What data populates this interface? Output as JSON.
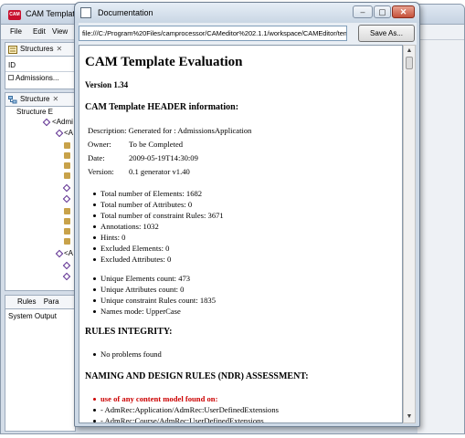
{
  "main_window": {
    "title": "CAM Template",
    "menu": [
      "File",
      "Edit",
      "View"
    ],
    "structures_panel": {
      "tab": "Structures",
      "id_label": "ID",
      "item": "Admissions..."
    },
    "structure_panel": {
      "tab": "Structure",
      "tab_suffix": "Structure E",
      "root_node": "Structure E",
      "child_prefix_1": "<Admi",
      "child_prefix_2": "<A",
      "child_prefix_3": "<A"
    },
    "bottom_tabs": [
      "Rules",
      "Para"
    ],
    "system_output_label": "System Output"
  },
  "doc_window": {
    "title": "Documentation",
    "url": "file:///C:/Program%20Files/camprocessor/CAMeditor%202.1.1/workspace/CAMEditor/tem",
    "save_as": "Save As..."
  },
  "report": {
    "title": "CAM Template Evaluation",
    "version": "Version 1.34",
    "header_section": "CAM Template HEADER information:",
    "description": "Description: Generated for : AdmissionsApplication",
    "owner_label": "Owner:",
    "owner_value": "To be Completed",
    "date_label": "Date:",
    "date_value": "2009-05-19T14:30:09",
    "version_label": "Version:",
    "version_value": "0.1 generator v1.40",
    "counts": [
      "Total number of Elements: 1682",
      "Total number of Attributes: 0",
      "Total number of constraint Rules: 3671",
      "Annotations: 1032",
      "Hints: 0",
      "Excluded Elements: 0",
      "Excluded Attributes: 0"
    ],
    "unique": [
      "Unique Elements count: 473",
      "Unique Attributes count: 0",
      "Unique constraint Rules count: 1835",
      "Names mode: UpperCase"
    ],
    "rules_section": "RULES INTEGRITY:",
    "rules_items": [
      "No problems found"
    ],
    "ndr_section": "NAMING AND DESIGN RULES (NDR) ASSESSMENT:",
    "ndr_highlight": "use of any content model found on:",
    "ndr_items": [
      "- AdmRec:Application/AdmRec:UserDefinedExtensions",
      "- AdmRec:Course/AdmRec:UserDefinedExtensions"
    ]
  },
  "colors": {
    "highlight": "#cc0000",
    "title_bar": "#cfdbe8",
    "close_button": "#c4513a"
  }
}
